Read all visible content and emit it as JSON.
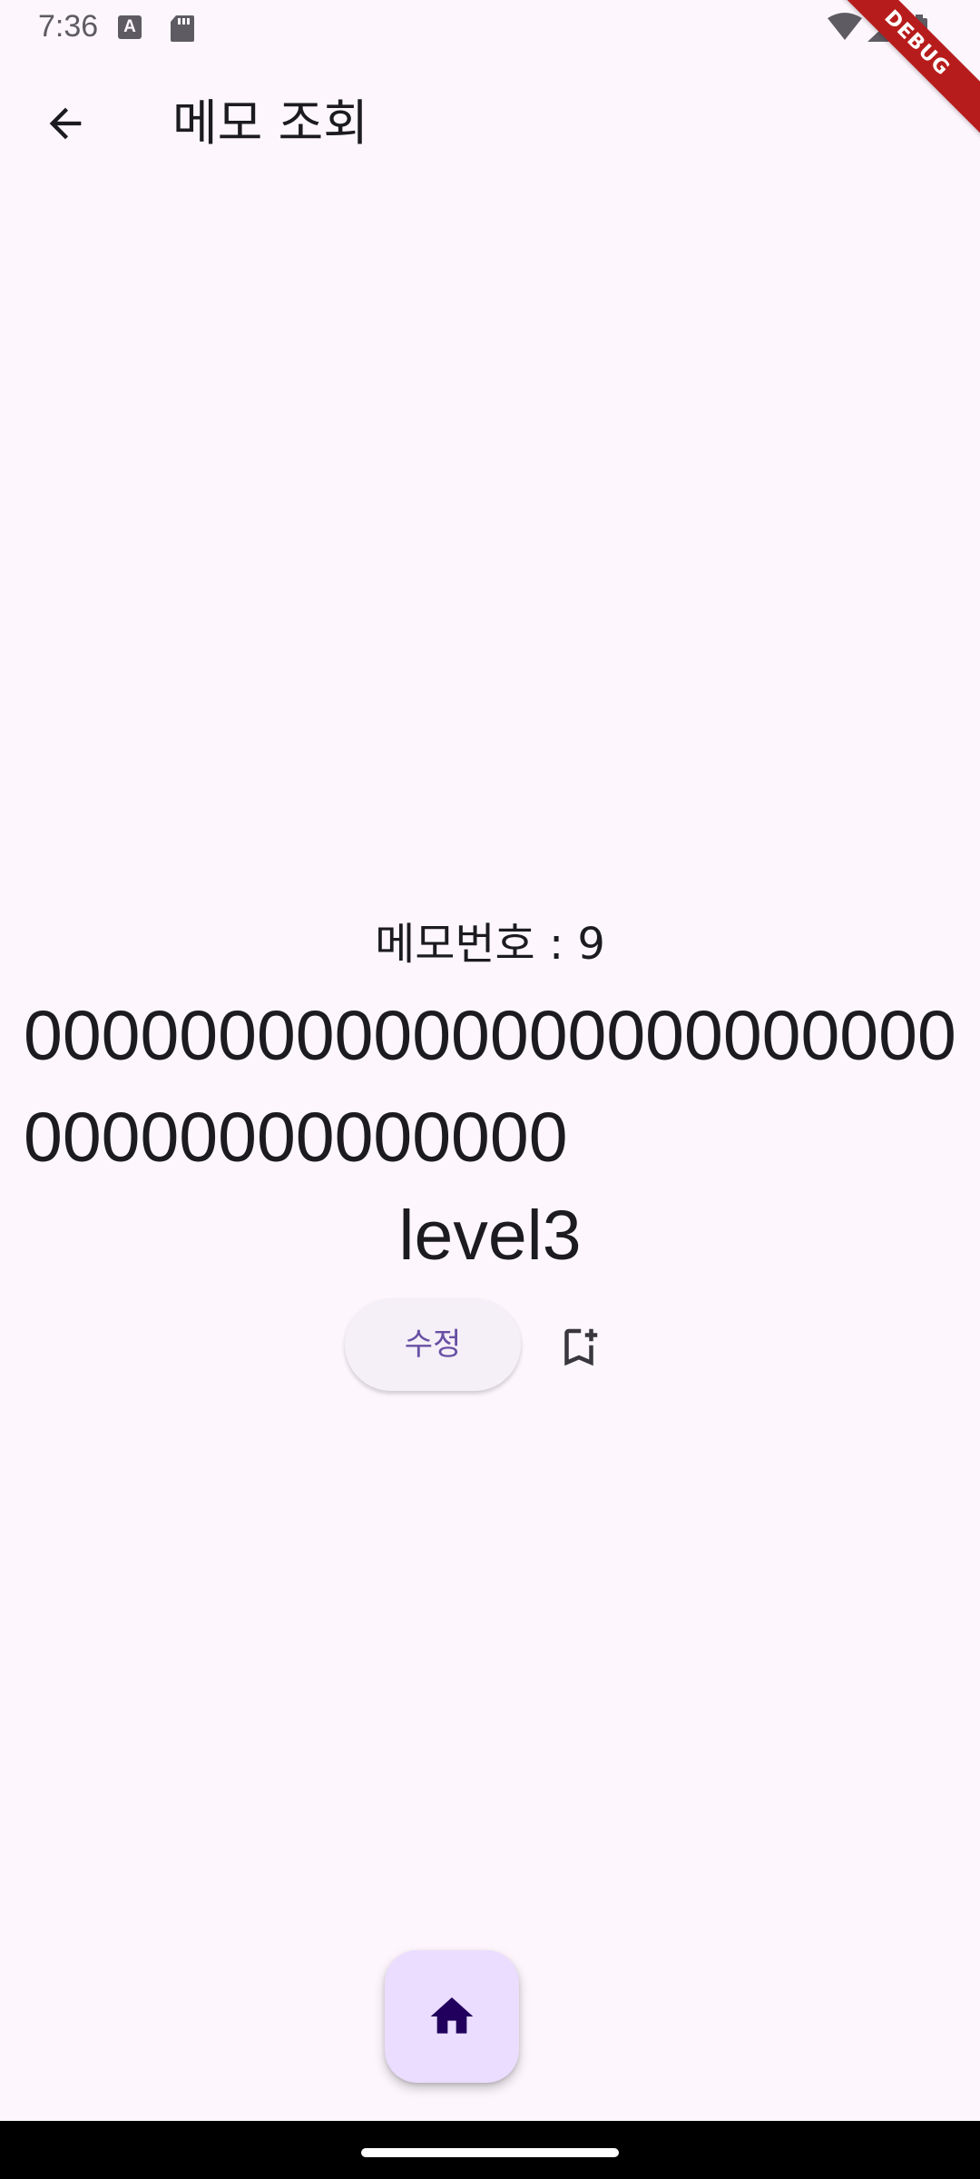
{
  "status_bar": {
    "time": "7:36",
    "icons": [
      "text-a-icon",
      "sd-card-icon",
      "wifi-icon",
      "signal-icon",
      "battery-icon"
    ],
    "icon_letter": "A"
  },
  "debug_banner": {
    "label": "DEBUG",
    "color": "#b71c1c"
  },
  "app_bar": {
    "title": "메모 조회",
    "back_icon": "arrow-back-icon"
  },
  "memo": {
    "number_label": "메모번호 : 9",
    "content": "00000000000000000000000000000000000000",
    "level": "level3"
  },
  "actions": {
    "edit_label": "수정",
    "bookmark_icon": "bookmark-add-icon"
  },
  "fab": {
    "icon": "home-icon"
  },
  "colors": {
    "background": "#fdf7fd",
    "primary": "#6750a4",
    "fab_background": "#eaddff",
    "fab_icon": "#21005d",
    "text": "#1c1b1f"
  }
}
